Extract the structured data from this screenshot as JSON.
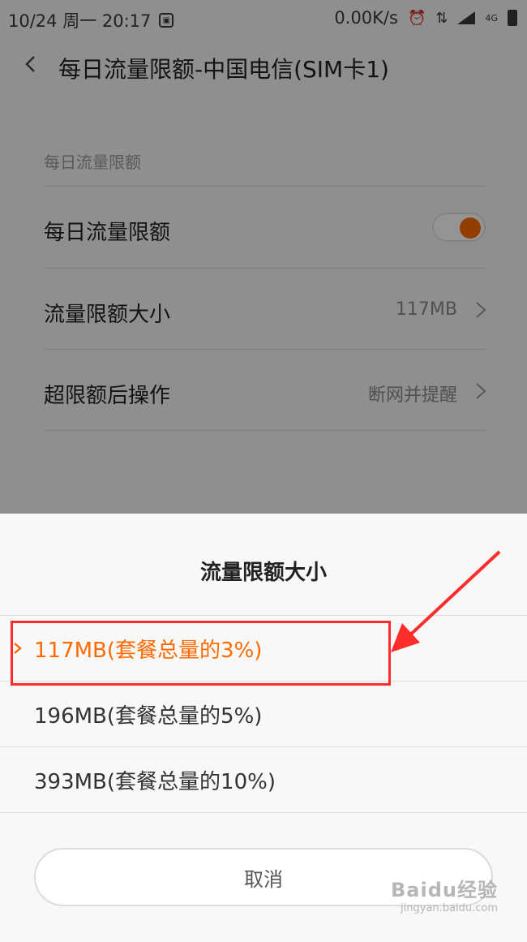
{
  "status_bar": {
    "datetime": "10/24 周一 20:17",
    "speed": "0.00K/s",
    "network": "4G"
  },
  "header": {
    "title": "每日流量限额-中国电信(SIM卡1)"
  },
  "settings": {
    "section_title": "每日流量限额",
    "rows": [
      {
        "label": "每日流量限额",
        "toggle": "on"
      },
      {
        "label": "流量限额大小",
        "value": "117MB"
      },
      {
        "label": "超限额后操作",
        "value": "断网并提醒"
      }
    ]
  },
  "sheet": {
    "title": "流量限额大小",
    "options": [
      {
        "label": "117MB(套餐总量的3%)",
        "selected": true
      },
      {
        "label": "196MB(套餐总量的5%)",
        "selected": false
      },
      {
        "label": "393MB(套餐总量的10%)",
        "selected": false
      }
    ],
    "cancel_label": "取消"
  },
  "annotation": {
    "color": "#ff2c2c",
    "target": "117MB(套餐总量的3%)"
  },
  "watermark": {
    "brand": "Baidu经验",
    "url": "jingyan.baidu.com"
  },
  "colors": {
    "accent": "#ff6a00",
    "dim_overlay": "rgba(0,0,0,0.42)"
  }
}
